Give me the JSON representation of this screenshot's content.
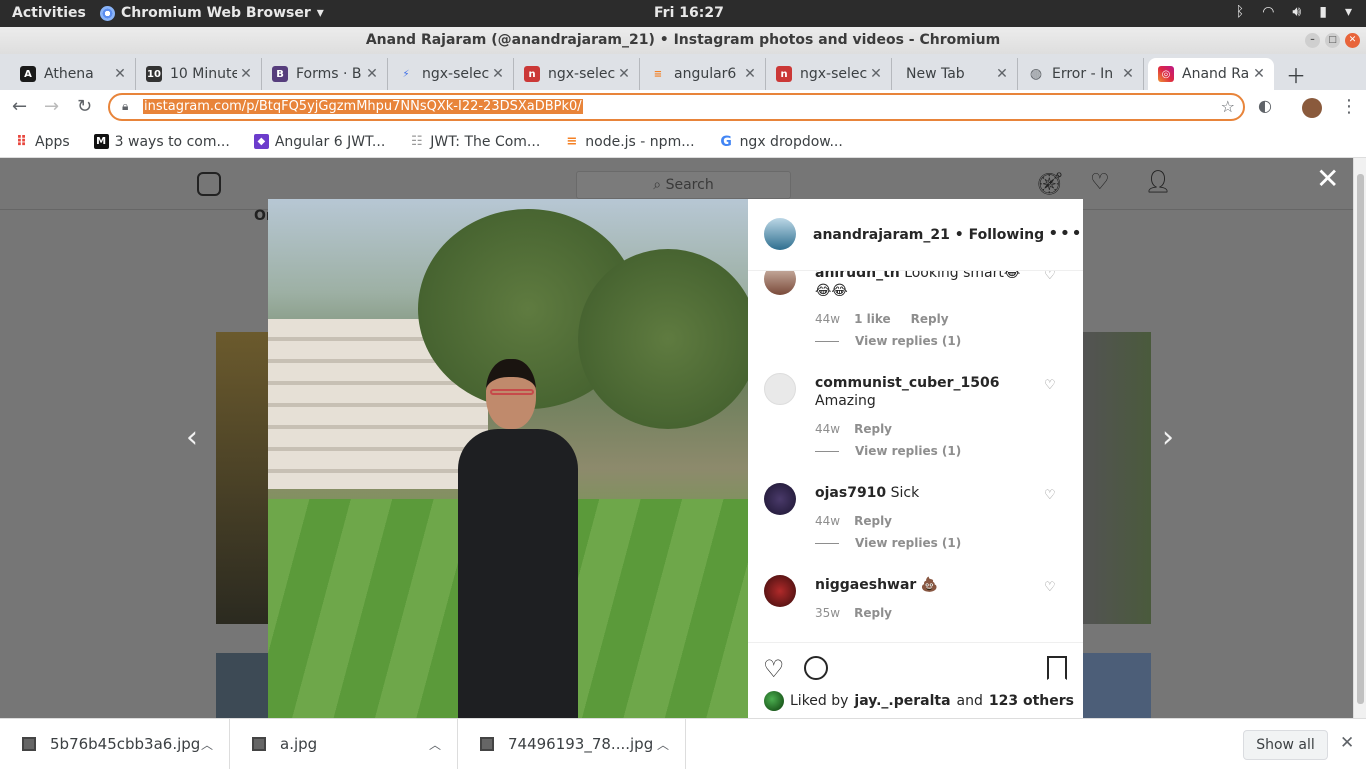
{
  "system_bar": {
    "activities": "Activities",
    "app_name": "Chromium Web Browser",
    "clock": "Fri 16:27"
  },
  "window": {
    "title": "Anand Rajaram (@anandrajaram_21) • Instagram photos and videos - Chromium"
  },
  "tabs": [
    {
      "label": "Athena",
      "icon": "athena-icon",
      "color": "#1a1a1a",
      "glyph": "A"
    },
    {
      "label": "10 Minute",
      "icon": "ten-minute-icon",
      "color": "#333333",
      "glyph": "10"
    },
    {
      "label": "Forms · B",
      "icon": "bootstrap-icon",
      "color": "#563d7c",
      "glyph": "B"
    },
    {
      "label": "ngx-selec",
      "icon": "lightning-icon",
      "color": "#ffffff",
      "glyph": "⚡"
    },
    {
      "label": "ngx-selec",
      "icon": "npm-icon",
      "color": "#cb3837",
      "glyph": "n"
    },
    {
      "label": "angular6",
      "icon": "stackoverflow-icon",
      "color": "#f48024",
      "glyph": "≡"
    },
    {
      "label": "ngx-selec",
      "icon": "npm-icon",
      "color": "#cb3837",
      "glyph": "n"
    },
    {
      "label": "New Tab",
      "icon": "",
      "color": "",
      "glyph": ""
    },
    {
      "label": "Error - In",
      "icon": "globe-icon",
      "color": "#5f6368",
      "glyph": "◍"
    },
    {
      "label": "Anand Ra",
      "icon": "instagram-icon",
      "color": "#c13584",
      "glyph": "◎"
    }
  ],
  "toolbar": {
    "url": "instagram.com/p/BtqFQ5yjGgzmMhpu7NNsQXk-I22-23DSXaDBPk0/"
  },
  "bookmarks": [
    {
      "label": "Apps",
      "icon": "apps-grid-icon"
    },
    {
      "label": "3 ways to com...",
      "icon": "medium-icon"
    },
    {
      "label": "Angular 6 JWT...",
      "icon": "bookmark-purple-icon"
    },
    {
      "label": "JWT: The Com...",
      "icon": "page-icon"
    },
    {
      "label": "node.js - npm...",
      "icon": "stackoverflow-icon"
    },
    {
      "label": "ngx dropdow...",
      "icon": "google-icon"
    }
  ],
  "instagram": {
    "search_placeholder": "Search",
    "partial_text": "Or"
  },
  "post": {
    "author": "anandrajaram_21",
    "follow_state": "Following",
    "comments": [
      {
        "user": "anirudh_th",
        "text": "Looking smart😂😂😂",
        "age": "44w",
        "likes": "1 like",
        "reply": "Reply",
        "view_replies": "View replies (1)"
      },
      {
        "user": "communist_cuber_1506",
        "text": "Amazing",
        "age": "44w",
        "reply": "Reply",
        "view_replies": "View replies (1)"
      },
      {
        "user": "ojas7910",
        "text": "Sick",
        "age": "44w",
        "reply": "Reply",
        "view_replies": "View replies (1)"
      },
      {
        "user": "niggaeshwar",
        "text": "💩",
        "age": "35w",
        "reply": "Reply"
      }
    ],
    "liked_by_prefix": "Liked by",
    "liked_by_user": "jay._.peralta",
    "liked_by_and": "and",
    "liked_by_others": "123 others"
  },
  "downloads": {
    "files": [
      "5b76b45cbb3a6.jpg",
      "a.jpg",
      "74496193_78....jpg"
    ],
    "show_all": "Show all"
  },
  "colors": {
    "accent_orange": "#e8843a",
    "instagram_text": "#262626",
    "muted": "#8e8e8e"
  }
}
